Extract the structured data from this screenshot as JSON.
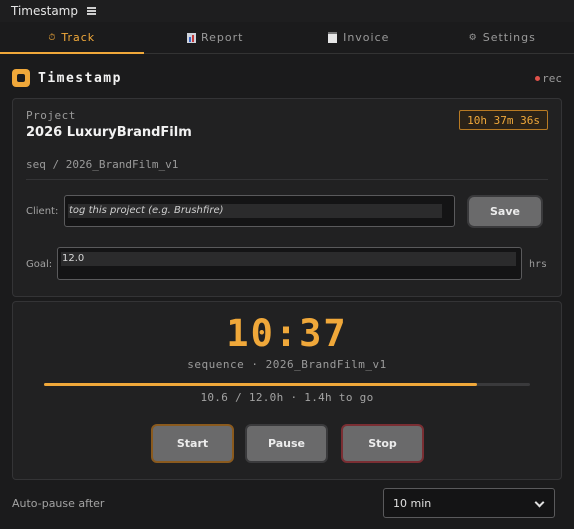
{
  "window": {
    "title": "Timestamp"
  },
  "tabs": [
    {
      "label": "Track",
      "icon": "stopwatch-icon",
      "active": true
    },
    {
      "label": "Report",
      "icon": "bar-chart-icon",
      "active": false
    },
    {
      "label": "Invoice",
      "icon": "document-icon",
      "active": false
    },
    {
      "label": "Settings",
      "icon": "gear-icon",
      "active": false
    }
  ],
  "header": {
    "title": "Timestamp",
    "rec": "rec",
    "accent_color": "#f0a83a",
    "rec_color": "#e0524a"
  },
  "project": {
    "label": "Project",
    "name": "2026 LuxuryBrandFilm",
    "elapsed": "10h 37m 36s",
    "sequence_path": "seq / 2026_BrandFilm_v1",
    "client_label": "Client:",
    "client_placeholder": "tog this project (e.g. Brushfire)",
    "save_label": "Save",
    "goal_label": "Goal:",
    "goal_value": "12.0",
    "goal_unit": "hrs"
  },
  "timer": {
    "clock": "10:37",
    "sequence_line": "sequence · 2026_BrandFilm_v1",
    "progress_fraction": 0.89,
    "progress_text": "10.6 / 12.0h · 1.4h to go",
    "start_label": "Start",
    "pause_label": "Pause",
    "stop_label": "Stop"
  },
  "autopause": {
    "label": "Auto-pause after",
    "selected": "10 min"
  }
}
